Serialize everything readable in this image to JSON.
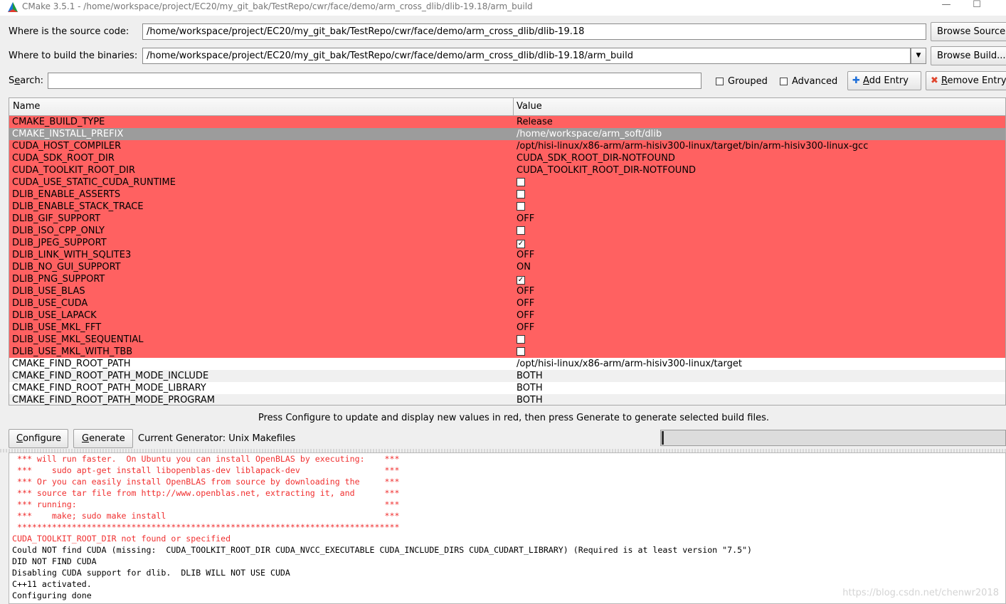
{
  "window": {
    "title": "CMake 3.5.1 - /home/workspace/project/EC20/my_git_bak/TestRepo/cwr/face/demo/arm_cross_dlib/dlib-19.18/arm_build",
    "minimize": "—",
    "maximize": "☐"
  },
  "source": {
    "label": "Where is the source code:",
    "value": "/home/workspace/project/EC20/my_git_bak/TestRepo/cwr/face/demo/arm_cross_dlib/dlib-19.18",
    "button": "Browse Source..."
  },
  "build": {
    "label": "Where to build the binaries:",
    "value": "/home/workspace/project/EC20/my_git_bak/TestRepo/cwr/face/demo/arm_cross_dlib/dlib-19.18/arm_build",
    "button": "Browse Build..."
  },
  "search": {
    "label_pre": "S",
    "label_ul": "e",
    "label_post": "arch:",
    "value": "",
    "grouped": "Grouped",
    "advanced": "Advanced",
    "add_pre": "",
    "add_ul": "A",
    "add_post": "dd Entry",
    "remove_pre": "",
    "remove_ul": "R",
    "remove_post": "emove Entry"
  },
  "table": {
    "col_name": "Name",
    "col_value": "Value",
    "rows": [
      {
        "name": "CMAKE_BUILD_TYPE",
        "value": "Release"
      },
      {
        "name": "CMAKE_INSTALL_PREFIX",
        "value": "/home/workspace/arm_soft/dlib"
      },
      {
        "name": "CUDA_HOST_COMPILER",
        "value": "/opt/hisi-linux/x86-arm/arm-hisiv300-linux/target/bin/arm-hisiv300-linux-gcc"
      },
      {
        "name": "CUDA_SDK_ROOT_DIR",
        "value": "CUDA_SDK_ROOT_DIR-NOTFOUND"
      },
      {
        "name": "CUDA_TOOLKIT_ROOT_DIR",
        "value": "CUDA_TOOLKIT_ROOT_DIR-NOTFOUND"
      },
      {
        "name": "CUDA_USE_STATIC_CUDA_RUNTIME",
        "value": ""
      },
      {
        "name": "DLIB_ENABLE_ASSERTS",
        "value": ""
      },
      {
        "name": "DLIB_ENABLE_STACK_TRACE",
        "value": ""
      },
      {
        "name": "DLIB_GIF_SUPPORT",
        "value": "OFF"
      },
      {
        "name": "DLIB_ISO_CPP_ONLY",
        "value": ""
      },
      {
        "name": "DLIB_JPEG_SUPPORT",
        "value": ""
      },
      {
        "name": "DLIB_LINK_WITH_SQLITE3",
        "value": "OFF"
      },
      {
        "name": "DLIB_NO_GUI_SUPPORT",
        "value": "ON"
      },
      {
        "name": "DLIB_PNG_SUPPORT",
        "value": ""
      },
      {
        "name": "DLIB_USE_BLAS",
        "value": "OFF"
      },
      {
        "name": "DLIB_USE_CUDA",
        "value": "OFF"
      },
      {
        "name": "DLIB_USE_LAPACK",
        "value": "OFF"
      },
      {
        "name": "DLIB_USE_MKL_FFT",
        "value": "OFF"
      },
      {
        "name": "DLIB_USE_MKL_SEQUENTIAL",
        "value": ""
      },
      {
        "name": "DLIB_USE_MKL_WITH_TBB",
        "value": ""
      },
      {
        "name": "CMAKE_FIND_ROOT_PATH",
        "value": "/opt/hisi-linux/x86-arm/arm-hisiv300-linux/target"
      },
      {
        "name": "CMAKE_FIND_ROOT_PATH_MODE_INCLUDE",
        "value": "BOTH"
      },
      {
        "name": "CMAKE_FIND_ROOT_PATH_MODE_LIBRARY",
        "value": "BOTH"
      },
      {
        "name": "CMAKE_FIND_ROOT_PATH_MODE_PROGRAM",
        "value": "BOTH"
      }
    ]
  },
  "hint": "Press Configure to update and display new values in red, then press Generate to generate selected build files.",
  "actions": {
    "configure_ul": "C",
    "configure_post": "onfigure",
    "generate_ul": "G",
    "generate_post": "enerate",
    "generator": "Current Generator: Unix Makefiles"
  },
  "output": [
    " *** will run faster.  On Ubuntu you can install OpenBLAS by executing:    ***",
    " ***    sudo apt-get install libopenblas-dev liblapack-dev                 ***",
    " *** Or you can easily install OpenBLAS from source by downloading the     ***",
    " *** source tar file from http://www.openblas.net, extracting it, and      ***",
    " *** running:                                                              ***",
    " ***    make; sudo make install                                            ***",
    " *****************************************************************************",
    "CUDA_TOOLKIT_ROOT_DIR not found or specified",
    "Could NOT find CUDA (missing:  CUDA_TOOLKIT_ROOT_DIR CUDA_NVCC_EXECUTABLE CUDA_INCLUDE_DIRS CUDA_CUDART_LIBRARY) (Required is at least version \"7.5\")",
    "DID NOT FIND CUDA",
    "Disabling CUDA support for dlib.  DLIB WILL NOT USE CUDA",
    "C++11 activated.",
    "Configuring done"
  ],
  "watermark": "https://blog.csdn.net/chenwr2018"
}
